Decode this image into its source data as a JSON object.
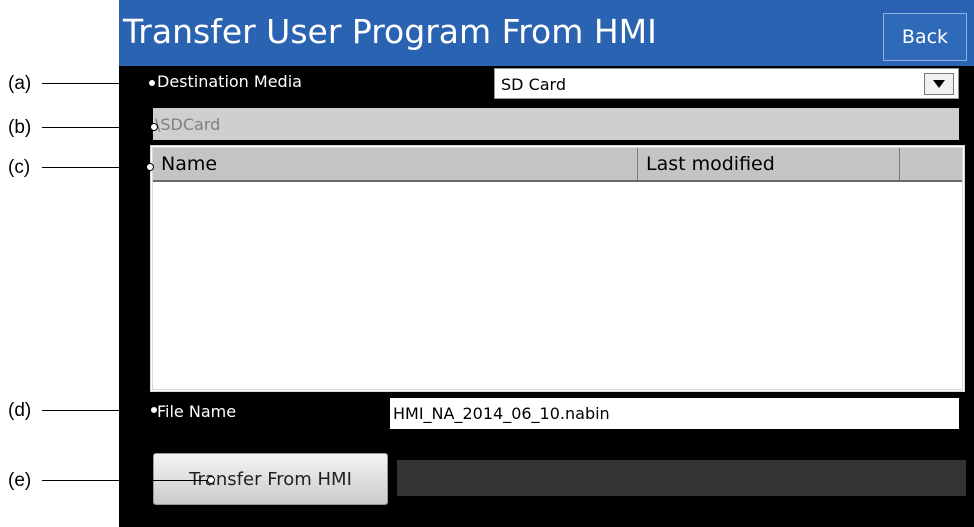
{
  "window": {
    "title": "Transfer User Program From HMI",
    "back_label": "Back"
  },
  "destination": {
    "label": "Destination Media",
    "selected": "SD Card"
  },
  "path": {
    "value": "\\SDCard"
  },
  "file_list": {
    "columns": [
      "Name",
      "Last modified",
      ""
    ],
    "rows": []
  },
  "file_name": {
    "label": "File Name",
    "value": "HMI_NA_2014_06_10.nabin"
  },
  "transfer_button": {
    "label": "Transfer From HMI"
  },
  "callouts": [
    "(a)",
    "(b)",
    "(c)",
    "(d)",
    "(e)"
  ],
  "colors": {
    "title_bar": "#2b63b3",
    "panel_bg": "#000000",
    "header_bg": "#c4c4c4"
  }
}
